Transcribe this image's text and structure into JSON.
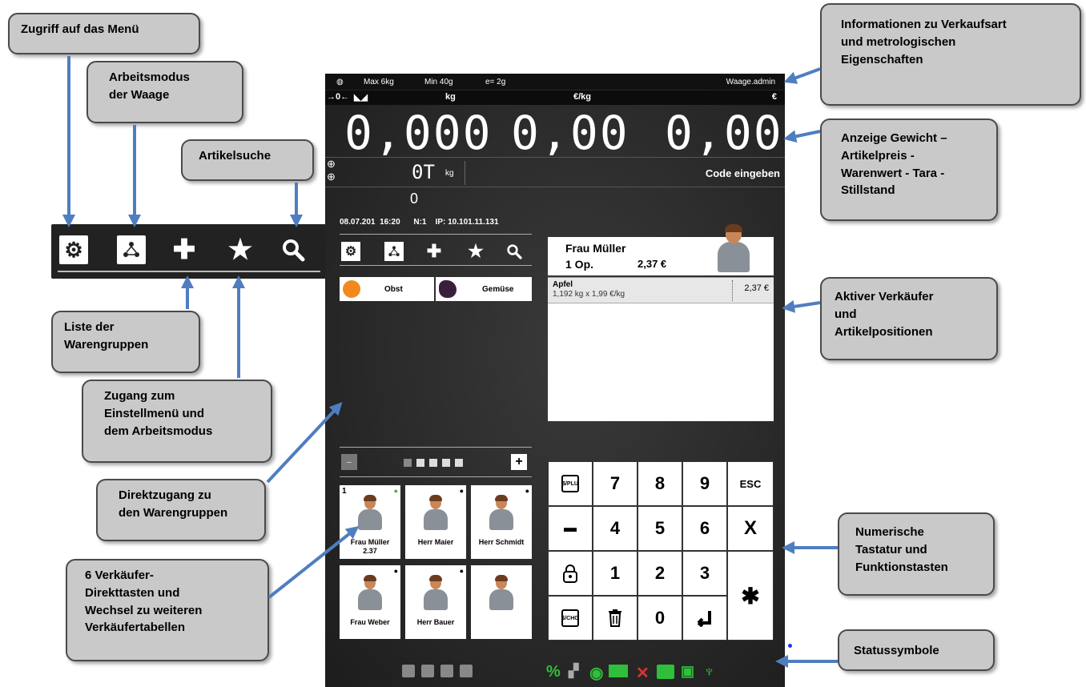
{
  "callouts": {
    "menu": "Zugriff auf das Menü",
    "workmode": "Arbeitsmodus\nder Waage",
    "search": "Artikelsuche",
    "groups": "Liste der\nWarengruppen",
    "settings": "Zugang zum\nEinstellmenü und\ndem Arbeitsmodus",
    "direct": "Direktzugang zu\nden Warengruppen",
    "sellers": "6 Verkäufer-\nDirekttasten und\nWechsel zu weiteren\nVerkäufertabellen",
    "info": "Informationen zu Verkaufsart\nund metrologischen\nEigenschaften",
    "display": "Anzeige Gewicht –\nArtikelpreis -\nWarenwert - Tara -\nStillstand",
    "active": "Aktiver Verkäufer\nund\nArtikelpositionen",
    "keypad": "Numerische\nTastatur und\nFunktionstasten",
    "status": "Statussymbole"
  },
  "device": {
    "info": {
      "max": "Max 6kg",
      "min": "Min 40g",
      "e": "e= 2g",
      "user": "Waage.admin"
    },
    "units": {
      "weight": "kg",
      "price": "€/kg",
      "total": "€"
    },
    "display": {
      "weight": "0,000",
      "price": "0,00",
      "total": "0,00"
    },
    "tara": {
      "value": "0T",
      "unit": "kg",
      "code_prompt": "Code eingeben",
      "counter": "0"
    },
    "status_line": {
      "date": "08.07.201",
      "time": "16:20",
      "n": "N:1",
      "ip": "IP: 10.101.11.131"
    },
    "groups": [
      {
        "label": "Obst"
      },
      {
        "label": "Gemüse"
      }
    ],
    "pager": {
      "minus": "–",
      "plus": "+"
    },
    "sellers": [
      {
        "num": "1",
        "name": "Frau Müller",
        "amount": "2.37"
      },
      {
        "num": "",
        "name": "Herr Maier",
        "amount": ""
      },
      {
        "num": "",
        "name": "Herr Schmidt",
        "amount": ""
      },
      {
        "num": "",
        "name": "Frau Weber",
        "amount": ""
      },
      {
        "num": "",
        "name": "Herr Bauer",
        "amount": ""
      },
      {
        "num": "",
        "name": "",
        "amount": ""
      }
    ],
    "customer": {
      "name": "Frau Müller",
      "ops": "1 Op.",
      "total": "2,37 €"
    },
    "positions": [
      {
        "name": "Apfel",
        "detail": "1,192 kg x 1,99 €/kg",
        "price": "2,37 €"
      }
    ],
    "keys": {
      "k7": "7",
      "k8": "8",
      "k9": "9",
      "esc": "ESC",
      "minus": "▬",
      "k4": "4",
      "k5": "5",
      "k6": "6",
      "x": "X",
      "k1": "1",
      "k2": "2",
      "k3": "3",
      "star": "✱",
      "k0": "0",
      "plu": "$/PLU",
      "chg": "$/CHG"
    },
    "status_icons": [
      "percent-icon",
      "network-icon",
      "drop-icon",
      "cash-icon",
      "cancel-icon",
      "printer-icon",
      "pc-icon",
      "scales-icon"
    ],
    "status_percent": "%"
  }
}
